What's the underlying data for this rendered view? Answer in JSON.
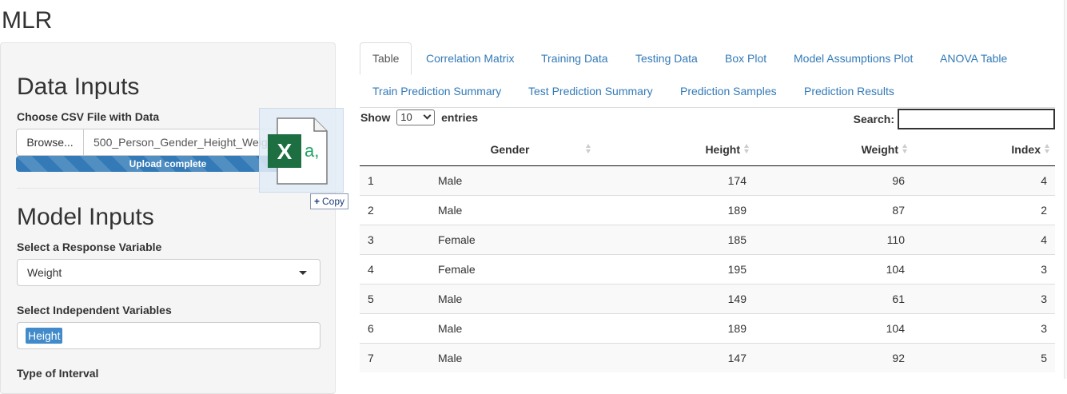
{
  "app": {
    "title": "MLR"
  },
  "sidebar": {
    "data_inputs_heading": "Data Inputs",
    "file_label": "Choose CSV File with Data",
    "browse_label": "Browse...",
    "file_name": "500_Person_Gender_Height_Weight_Index",
    "upload_status": "Upload complete",
    "upload_progress_percent": 100,
    "model_inputs_heading": "Model Inputs",
    "response_label": "Select a Response Variable",
    "response_value": "Weight",
    "independent_label": "Select Independent Variables",
    "independent_selected": [
      "Height"
    ],
    "interval_label": "Type of Interval"
  },
  "drag_overlay": {
    "icon_letter": "X",
    "icon_text": "a,",
    "copy_label": "Copy"
  },
  "tabs": [
    {
      "label": "Table",
      "active": true
    },
    {
      "label": "Correlation Matrix"
    },
    {
      "label": "Training Data"
    },
    {
      "label": "Testing Data"
    },
    {
      "label": "Box Plot"
    },
    {
      "label": "Model Assumptions Plot"
    },
    {
      "label": "ANOVA Table"
    },
    {
      "label": "Train Prediction Summary"
    },
    {
      "label": "Test Prediction Summary"
    },
    {
      "label": "Prediction Samples"
    },
    {
      "label": "Prediction Results"
    }
  ],
  "datatable": {
    "show_label": "Show",
    "page_length": "10",
    "entries_label": "entries",
    "search_label": "Search:",
    "search_value": "",
    "columns": [
      "",
      "Gender",
      "Height",
      "Weight",
      "Index"
    ],
    "rows": [
      [
        "1",
        "Male",
        "174",
        "96",
        "4"
      ],
      [
        "2",
        "Male",
        "189",
        "87",
        "2"
      ],
      [
        "3",
        "Female",
        "185",
        "110",
        "4"
      ],
      [
        "4",
        "Female",
        "195",
        "104",
        "3"
      ],
      [
        "5",
        "Male",
        "149",
        "61",
        "3"
      ],
      [
        "6",
        "Male",
        "189",
        "104",
        "3"
      ],
      [
        "7",
        "Male",
        "147",
        "92",
        "5"
      ]
    ]
  },
  "colors": {
    "link": "#337ab7",
    "progress": "#337ab7",
    "excel_green": "#1d6f42",
    "chip": "#428bca"
  }
}
